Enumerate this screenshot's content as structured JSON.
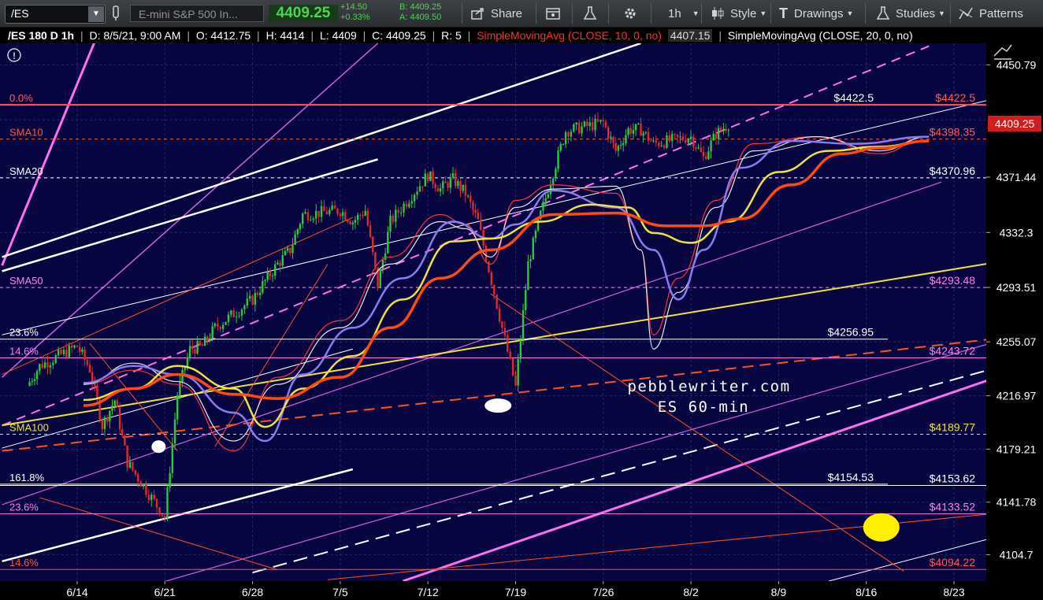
{
  "toolbar": {
    "symbol": "/ES",
    "description": "E-mini S&P 500 In...",
    "last": "4409.25",
    "change": "+14.50",
    "change_pct": "+0.33%",
    "bid": "B: 4409.25",
    "ask": "A: 4409.50",
    "share_label": "Share",
    "timeframe_label": "1h",
    "style_label": "Style",
    "drawings_label": "Drawings",
    "studies_label": "Studies",
    "patterns_label": "Patterns"
  },
  "info_bar": {
    "symbol": "/ES 180 D 1h",
    "date": "D: 8/5/21, 9:00 AM",
    "open": "O: 4412.75",
    "high": "H: 4414",
    "low": "L: 4409",
    "close": "C: 4409.25",
    "r": "R: 5",
    "sma10_label": "SimpleMovingAvg (CLOSE, 10, 0, no)",
    "sma10_value": "4407.15",
    "sma20_label": "SimpleMovingAvg (CLOSE, 20, 0, no)"
  },
  "colors": {
    "background": "#070540",
    "sma10": "#ff3333",
    "sma20": "#e8e8e8",
    "sma50": "#8a7cf0",
    "sma100": "#f0e23a",
    "sma200": "#ff4a10",
    "channel_pink": "#ff70ee",
    "up": "#2ec93a",
    "down": "#e12a2a"
  },
  "chart_data": {
    "type": "candlestick",
    "interval": "1h",
    "watermark": [
      "pebblewriter.com",
      "ES 60-min"
    ],
    "ylim": [
      4086,
      4466
    ],
    "y_ticks": [
      4450.79,
      4411.96,
      4371.44,
      4332.3,
      4293.51,
      4255.07,
      4216.97,
      4179.21,
      4141.78,
      4104.7
    ],
    "x_ticks": [
      "6/14",
      "6/21",
      "6/28",
      "7/5",
      "7/12",
      "7/19",
      "7/26",
      "8/2",
      "8/9",
      "8/16",
      "8/23"
    ],
    "current_price": "4409.25",
    "horizontal_levels": [
      {
        "name": "fib-0",
        "value": 4422.5,
        "left_label": "0.0%",
        "mid_label": "$4422.5",
        "right_label": "$4422.5",
        "color": "#ff5a5a",
        "style": "solid"
      },
      {
        "name": "sma10",
        "value": 4398.35,
        "left_label": "SMA10",
        "mid_label": "",
        "right_label": "$4398.35",
        "color": "#ff5533",
        "style": "dashed"
      },
      {
        "name": "sma20",
        "value": 4370.96,
        "left_label": "SMA20",
        "mid_label": "",
        "right_label": "$4370.96",
        "color": "#ffffff",
        "style": "dashed"
      },
      {
        "name": "sma50",
        "value": 4293.48,
        "left_label": "SMA50",
        "mid_label": "",
        "right_label": "$4293.48",
        "color": "#ff80f0",
        "style": "dashed"
      },
      {
        "name": "fib-23.6-upper",
        "value": 4256.95,
        "left_label": "23.6%",
        "mid_label": "$4256.95",
        "right_label": "",
        "color": "#ffffff",
        "style": "solid"
      },
      {
        "name": "fib-14.6-upper",
        "value": 4243.72,
        "left_label": "14.6%",
        "mid_label": "",
        "right_label": "$4243.72",
        "color": "#ff80f0",
        "style": "solid"
      },
      {
        "name": "sma100",
        "value": 4189.77,
        "left_label": "SMA100",
        "mid_label": "",
        "right_label": "$4189.77",
        "color": "#f0e23a",
        "style": "dashed"
      },
      {
        "name": "fib-161.8",
        "value": 4154.53,
        "left_label": "161.8%",
        "mid_label": "$4154.53",
        "right_label": "",
        "color": "#ffffff",
        "style": "solid"
      },
      {
        "name": "level-4153",
        "value": 4153.62,
        "left_label": "",
        "mid_label": "",
        "right_label": "$4153.62",
        "color": "#ffffff",
        "style": "solid"
      },
      {
        "name": "fib-23.6-lower",
        "value": 4133.52,
        "left_label": "23.6%",
        "mid_label": "",
        "right_label": "$4133.52",
        "color": "#ff80f0",
        "style": "solid"
      },
      {
        "name": "fib-14.6-lower",
        "value": 4094.22,
        "left_label": "14.6%",
        "mid_label": "",
        "right_label": "$4094.22",
        "color": "#ff5533",
        "style": "solid"
      }
    ],
    "price_path": [
      [
        "6/10",
        4224
      ],
      [
        "6/11",
        4238
      ],
      [
        "6/14",
        4252
      ],
      [
        "6/15",
        4236
      ],
      [
        "6/16",
        4196
      ],
      [
        "6/17",
        4214
      ],
      [
        "6/18",
        4170
      ],
      [
        "6/21",
        4131
      ],
      [
        "6/22",
        4218
      ],
      [
        "6/23",
        4250
      ],
      [
        "6/24",
        4252
      ],
      [
        "6/25",
        4265
      ],
      [
        "6/28",
        4285
      ],
      [
        "6/29",
        4298
      ],
      [
        "6/30",
        4310
      ],
      [
        "7/1",
        4320
      ],
      [
        "7/2",
        4345
      ],
      [
        "7/5",
        4348
      ],
      [
        "7/6",
        4340
      ],
      [
        "7/7",
        4348
      ],
      [
        "7/8",
        4295
      ],
      [
        "7/9",
        4340
      ],
      [
        "7/12",
        4373
      ],
      [
        "7/13",
        4363
      ],
      [
        "7/14",
        4370
      ],
      [
        "7/15",
        4360
      ],
      [
        "7/16",
        4340
      ],
      [
        "7/19",
        4223
      ],
      [
        "7/20",
        4310
      ],
      [
        "7/21",
        4345
      ],
      [
        "7/22",
        4375
      ],
      [
        "7/23",
        4404
      ],
      [
        "7/26",
        4410
      ],
      [
        "7/27",
        4390
      ],
      [
        "7/28",
        4405
      ],
      [
        "7/29",
        4405
      ],
      [
        "7/30",
        4395
      ],
      [
        "8/2",
        4400
      ],
      [
        "8/3",
        4385
      ],
      [
        "8/4",
        4402
      ],
      [
        "8/5",
        4409
      ]
    ],
    "series": [
      {
        "name": "SMA10",
        "values": [
          [
            6.5,
            4225
          ],
          [
            10.5,
            4235
          ],
          [
            14,
            4225
          ],
          [
            18.5,
            4178
          ],
          [
            22,
            4230
          ],
          [
            27,
            4270
          ],
          [
            31,
            4315
          ],
          [
            35,
            4345
          ],
          [
            37,
            4338
          ],
          [
            39,
            4310
          ],
          [
            41,
            4355
          ],
          [
            44,
            4366
          ],
          [
            49,
            4360
          ],
          [
            51,
            4320
          ],
          [
            52,
            4260
          ],
          [
            54,
            4300
          ],
          [
            57,
            4355
          ],
          [
            60,
            4395
          ],
          [
            65,
            4400
          ],
          [
            70,
            4388
          ],
          [
            74,
            4400
          ]
        ]
      },
      {
        "name": "SMA20",
        "values": [
          [
            6.5,
            4225
          ],
          [
            10.5,
            4240
          ],
          [
            14,
            4227
          ],
          [
            18.5,
            4185
          ],
          [
            22,
            4225
          ],
          [
            27,
            4265
          ],
          [
            31,
            4310
          ],
          [
            35,
            4340
          ],
          [
            37,
            4335
          ],
          [
            39,
            4315
          ],
          [
            41,
            4350
          ],
          [
            44,
            4363
          ],
          [
            49,
            4365
          ],
          [
            51,
            4320
          ],
          [
            52,
            4250
          ],
          [
            54,
            4290
          ],
          [
            57,
            4350
          ],
          [
            60,
            4390
          ],
          [
            65,
            4400
          ],
          [
            70,
            4390
          ],
          [
            74,
            4400
          ]
        ]
      },
      {
        "name": "SMA50",
        "values": [
          [
            6.5,
            4226
          ],
          [
            10.5,
            4238
          ],
          [
            14,
            4232
          ],
          [
            18.5,
            4205
          ],
          [
            21,
            4185
          ],
          [
            24,
            4232
          ],
          [
            28,
            4265
          ],
          [
            32,
            4300
          ],
          [
            36,
            4340
          ],
          [
            39,
            4328
          ],
          [
            41,
            4338
          ],
          [
            44,
            4362
          ],
          [
            49,
            4350
          ],
          [
            52,
            4320
          ],
          [
            54,
            4285
          ],
          [
            56,
            4320
          ],
          [
            59,
            4378
          ],
          [
            63,
            4397
          ],
          [
            68,
            4395
          ],
          [
            74,
            4400
          ]
        ]
      },
      {
        "name": "SMA100",
        "values": [
          [
            6.5,
            4214
          ],
          [
            10.5,
            4222
          ],
          [
            14,
            4238
          ],
          [
            18.5,
            4222
          ],
          [
            21,
            4195
          ],
          [
            24,
            4222
          ],
          [
            28,
            4245
          ],
          [
            32,
            4285
          ],
          [
            36,
            4326
          ],
          [
            39,
            4328
          ],
          [
            43,
            4340
          ],
          [
            47,
            4352
          ],
          [
            50,
            4350
          ],
          [
            52,
            4332
          ],
          [
            55,
            4325
          ],
          [
            58,
            4340
          ],
          [
            62,
            4375
          ],
          [
            66,
            4390
          ],
          [
            70,
            4393
          ],
          [
            74,
            4397
          ]
        ]
      },
      {
        "name": "SMA200",
        "values": [
          [
            6.5,
            4210
          ],
          [
            10.5,
            4222
          ],
          [
            14,
            4232
          ],
          [
            18.5,
            4218
          ],
          [
            22,
            4215
          ],
          [
            27,
            4230
          ],
          [
            31,
            4265
          ],
          [
            35,
            4300
          ],
          [
            39,
            4320
          ],
          [
            44,
            4345
          ],
          [
            49,
            4346
          ],
          [
            53,
            4337
          ],
          [
            56,
            4337
          ],
          [
            59,
            4342
          ],
          [
            63,
            4366
          ],
          [
            67,
            4388
          ],
          [
            70,
            4392
          ],
          [
            74,
            4397
          ]
        ]
      }
    ],
    "annotations": [
      {
        "name": "white-oval-mid",
        "x": 39.6,
        "y": 4210,
        "color": "#ffffff"
      },
      {
        "name": "white-oval-left",
        "x": 12.5,
        "y": 4181,
        "color": "#ffffff"
      },
      {
        "name": "white-oval-right",
        "x": 85.8,
        "y": 4233,
        "color": "#ffffff"
      },
      {
        "name": "yellow-target",
        "x": 70.2,
        "y": 4124,
        "color": "#fff000"
      }
    ]
  }
}
